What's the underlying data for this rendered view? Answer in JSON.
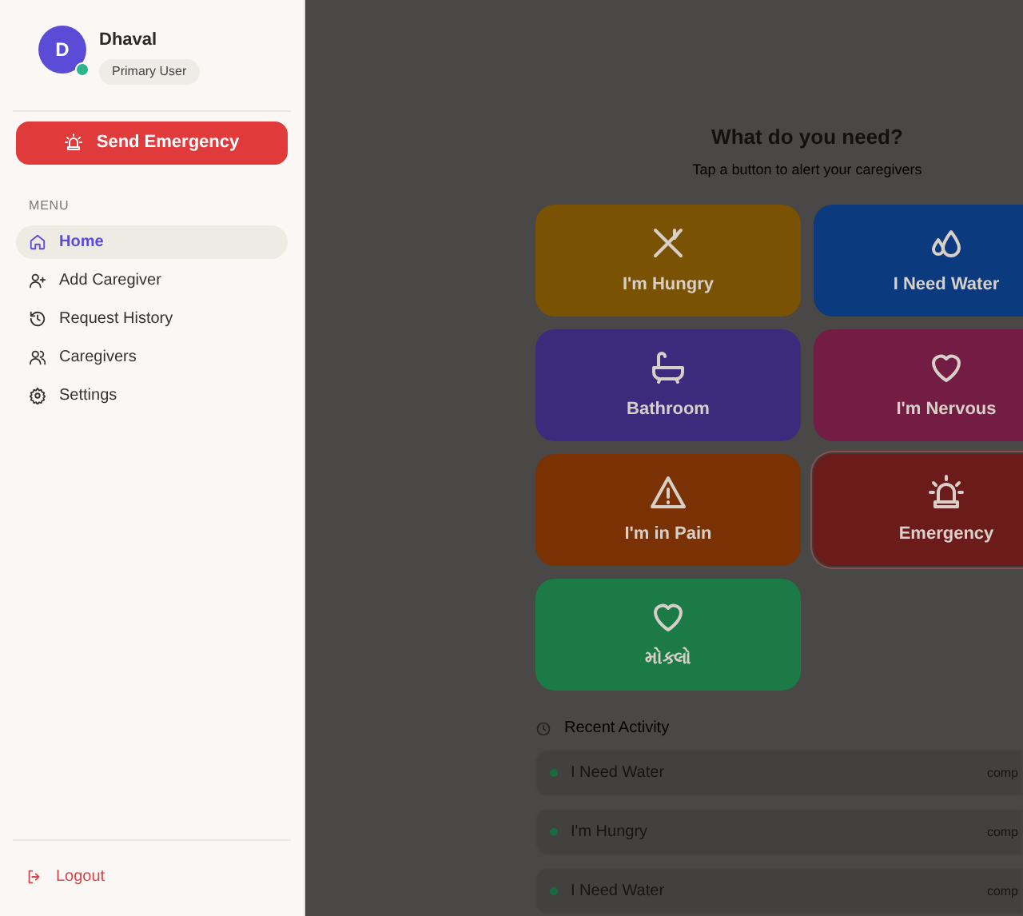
{
  "user": {
    "initial": "D",
    "name": "Dhaval",
    "role": "Primary User",
    "online": true
  },
  "emergency_button": {
    "label": "Send Emergency"
  },
  "menu": {
    "heading": "MENU",
    "items": [
      {
        "label": "Home",
        "selected": true
      },
      {
        "label": "Add Caregiver",
        "selected": false
      },
      {
        "label": "Request History",
        "selected": false
      },
      {
        "label": "Caregivers",
        "selected": false
      },
      {
        "label": "Settings",
        "selected": false
      }
    ]
  },
  "logout": {
    "label": "Logout"
  },
  "main": {
    "title": "What do you need?",
    "subtitle": "Tap a button to alert your caregivers",
    "requests": [
      {
        "label": "I'm Hungry",
        "color": "#7a5204",
        "kind": "normal"
      },
      {
        "label": "I Need Water",
        "color": "#0c3a7e",
        "kind": "normal"
      },
      {
        "label": "Bathroom",
        "color": "#3c2a7c",
        "kind": "normal"
      },
      {
        "label": "I'm Nervous",
        "color": "#731d44",
        "kind": "normal"
      },
      {
        "label": "I'm in Pain",
        "color": "#7a3104",
        "kind": "normal"
      },
      {
        "label": "Emergency",
        "color": "#6c1b1b",
        "kind": "emergency"
      },
      {
        "label": "મોક્લો",
        "color": "#1b7a46",
        "kind": "normal"
      }
    ],
    "recent_heading": "Recent Activity",
    "recent": [
      {
        "label": "I Need Water",
        "status": "comp",
        "color": "#1b6b40"
      },
      {
        "label": "I'm Hungry",
        "status": "comp",
        "color": "#1b6b40"
      },
      {
        "label": "I Need Water",
        "status": "comp",
        "color": "#1b6b40"
      }
    ]
  }
}
